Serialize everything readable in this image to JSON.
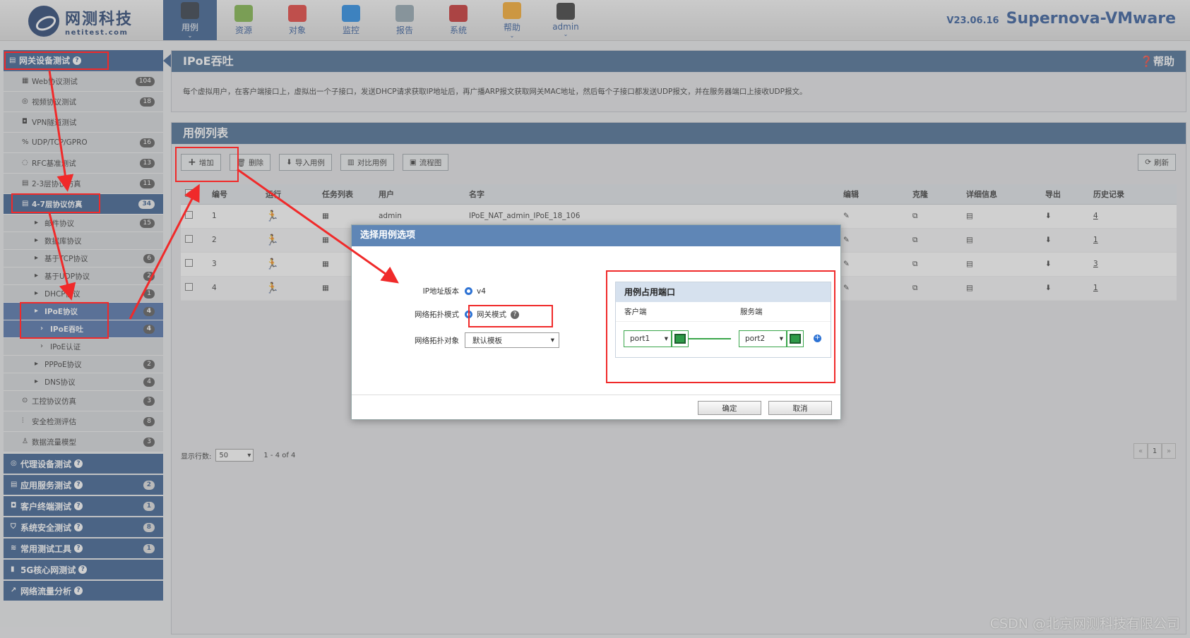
{
  "logo": {
    "cn": "网测科技",
    "en": "netitest.com"
  },
  "nav": [
    {
      "label": "用例",
      "icon": "monitor-icon",
      "color": "#2a3340",
      "active": true
    },
    {
      "label": "资源",
      "icon": "resource-icon",
      "color": "#7cb342"
    },
    {
      "label": "对象",
      "icon": "object-icon",
      "color": "#e53935"
    },
    {
      "label": "监控",
      "icon": "monitor-globe-icon",
      "color": "#1e88e5"
    },
    {
      "label": "报告",
      "icon": "report-icon",
      "color": "#90a4ae"
    },
    {
      "label": "系统",
      "icon": "tools-icon",
      "color": "#c62828"
    },
    {
      "label": "帮助",
      "icon": "help-folder-icon",
      "color": "#f9a825"
    },
    {
      "label": "admin",
      "icon": "user-icon",
      "color": "#333333"
    }
  ],
  "version": {
    "num": "V23.06.16",
    "name": "Supernova-VMware"
  },
  "sidebar": {
    "head": {
      "label": "网关设备测试"
    },
    "items": [
      {
        "label": "Web协议测试",
        "badge": "104"
      },
      {
        "label": "视频协议测试",
        "badge": "18"
      },
      {
        "label": "VPN隧道测试",
        "badge": ""
      },
      {
        "label": "UDP/TCP/GPRO",
        "badge": "16"
      },
      {
        "label": "RFC基准测试",
        "badge": "13"
      },
      {
        "label": "2-3层协议仿真",
        "badge": "11"
      },
      {
        "label": "4-7层协议仿真",
        "badge": "34"
      }
    ],
    "sub": [
      {
        "label": "邮件协议",
        "badge": "15"
      },
      {
        "label": "数据库协议",
        "badge": ""
      },
      {
        "label": "基于TCP协议",
        "badge": "6"
      },
      {
        "label": "基于UDP协议",
        "badge": "2"
      },
      {
        "label": "DHCP协议",
        "badge": "1"
      },
      {
        "label": "IPoE协议",
        "badge": "4"
      },
      {
        "label": "IPoE吞吐",
        "badge": "4"
      },
      {
        "label": "IPoE认证",
        "badge": ""
      },
      {
        "label": "PPPoE协议",
        "badge": "2"
      },
      {
        "label": "DNS协议",
        "badge": "4"
      }
    ],
    "items2": [
      {
        "label": "工控协议仿真",
        "badge": "3"
      },
      {
        "label": "安全检测评估",
        "badge": "8"
      },
      {
        "label": "数据流量模型",
        "badge": "3"
      }
    ],
    "groups": [
      {
        "label": "代理设备测试",
        "badge": ""
      },
      {
        "label": "应用服务测试",
        "badge": "2"
      },
      {
        "label": "客户终端测试",
        "badge": "1"
      },
      {
        "label": "系统安全测试",
        "badge": "8"
      },
      {
        "label": "常用测试工具",
        "badge": "1"
      },
      {
        "label": "5G核心网测试",
        "badge": ""
      },
      {
        "label": "网络流量分析",
        "badge": ""
      }
    ]
  },
  "top_panel": {
    "title": "IPoE吞吐",
    "help": "❓帮助",
    "desc": "每个虚拟用户，在客户端接口上，虚拟出一个子接口，发送DHCP请求获取IP地址后，再广播ARP报文获取网关MAC地址，然后每个子接口都发送UDP报文，并在服务器端口上接收UDP报文。"
  },
  "list_panel": {
    "title": "用例列表",
    "buttons": {
      "add": "增加",
      "delete": "删除",
      "import": "导入用例",
      "compare": "对比用例",
      "flow": "流程图",
      "refresh": "刷新"
    },
    "columns": [
      "编号",
      "运行",
      "任务列表",
      "用户",
      "名字",
      "编辑",
      "克隆",
      "详细信息",
      "导出",
      "历史记录"
    ],
    "rows": [
      {
        "id": "1",
        "user": "admin",
        "name": "IPoE_NAT_admin_IPoE_18_106",
        "history": "4"
      },
      {
        "id": "2",
        "user": "",
        "name": "",
        "history": "1"
      },
      {
        "id": "3",
        "user": "",
        "name": "",
        "history": "3"
      },
      {
        "id": "4",
        "user": "",
        "name": "",
        "history": "1"
      }
    ],
    "rows_label": "显示行数:",
    "rows_value": "50",
    "range": "1 - 4 of 4",
    "page": "1"
  },
  "dialog": {
    "title": "选择用例选项",
    "ip_label": "IP地址版本",
    "ip_value": "v4",
    "mode_label": "网络拓扑模式",
    "mode_value": "网关模式",
    "target_label": "网络拓扑对象",
    "target_value": "默认模板",
    "ports_title": "用例占用端口",
    "client": "客户端",
    "server": "服务端",
    "port1": "port1",
    "port2": "port2",
    "ok": "确定",
    "cancel": "取消"
  },
  "watermark": "CSDN @北京网测科技有限公司",
  "colors": {
    "annotation": "#f02a2a",
    "nav_active": "#33598c",
    "panel_head": "#426890"
  }
}
